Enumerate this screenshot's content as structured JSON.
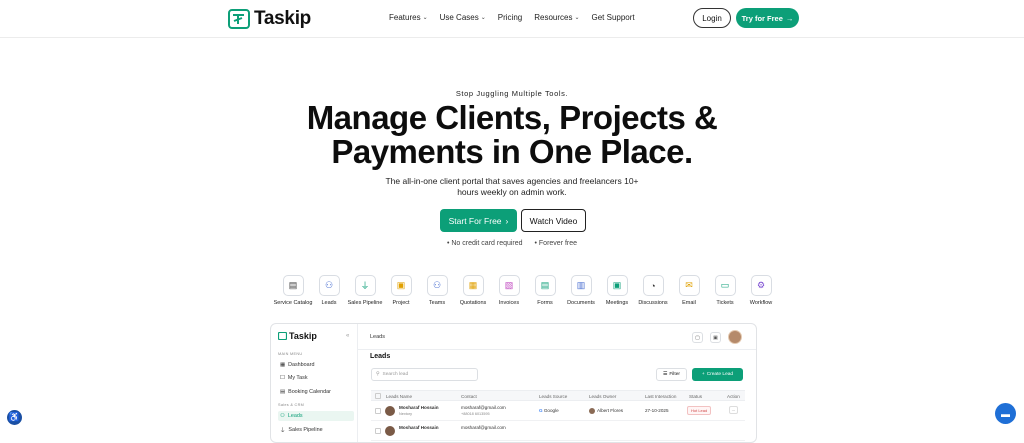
{
  "brand": {
    "name": "Taskip",
    "accent": "#0c9f78"
  },
  "nav": {
    "links": [
      {
        "label": "Features",
        "dropdown": true
      },
      {
        "label": "Use Cases",
        "dropdown": true
      },
      {
        "label": "Pricing",
        "dropdown": false
      },
      {
        "label": "Resources",
        "dropdown": true
      },
      {
        "label": "Get Support",
        "dropdown": false
      }
    ],
    "login": "Login",
    "try_free": "Try for Free"
  },
  "hero": {
    "eyebrow": "Stop Juggling Multiple Tools.",
    "headline_line1": "Manage Clients, Projects &",
    "headline_line2": "Payments in One Place.",
    "subtext": "The all-in-one client portal that saves agencies and freelancers 10+ hours weekly on admin work.",
    "start_button": "Start For Free",
    "watch_button": "Watch Video",
    "perk1": "• No credit card required",
    "perk2": "• Forever free"
  },
  "features": [
    {
      "label": "Service Catalog",
      "icon": "catalog-icon",
      "glyph": "▤",
      "color": "#3a3a3a"
    },
    {
      "label": "Leads",
      "icon": "leads-icon",
      "glyph": "⚇",
      "color": "#4a6fd1"
    },
    {
      "label": "Sales Pipeline",
      "icon": "pipeline-icon",
      "glyph": "⏚",
      "color": "#0c9f78"
    },
    {
      "label": "Project",
      "icon": "project-icon",
      "glyph": "▣",
      "color": "#e0a000"
    },
    {
      "label": "Teams",
      "icon": "teams-icon",
      "glyph": "⚇",
      "color": "#4a6fd1"
    },
    {
      "label": "Quotations",
      "icon": "quotations-icon",
      "glyph": "▦",
      "color": "#e0a000"
    },
    {
      "label": "Invoices",
      "icon": "invoices-icon",
      "glyph": "▧",
      "color": "#c04ac0"
    },
    {
      "label": "Forms",
      "icon": "forms-icon",
      "glyph": "▤",
      "color": "#0c9f78"
    },
    {
      "label": "Documents",
      "icon": "documents-icon",
      "glyph": "▥",
      "color": "#4a6fd1"
    },
    {
      "label": "Meetings",
      "icon": "meetings-icon",
      "glyph": "▣",
      "color": "#0c9f78"
    },
    {
      "label": "Discussions",
      "icon": "discussions-icon",
      "glyph": "◔",
      "color": "#333333"
    },
    {
      "label": "Email",
      "icon": "email-icon",
      "glyph": "✉",
      "color": "#e0a000"
    },
    {
      "label": "Tickets",
      "icon": "tickets-icon",
      "glyph": "▭",
      "color": "#0c9f78"
    },
    {
      "label": "Workflow",
      "icon": "workflow-icon",
      "glyph": "⚙",
      "color": "#7a4ad1"
    }
  ],
  "app": {
    "logo": "Taskip",
    "sidebar": {
      "section_main": "MAIN MENU",
      "section_sales": "Sales & CRM",
      "items": [
        {
          "label": "Dashboard",
          "icon": "dashboard-icon",
          "glyph": "▦",
          "active": false
        },
        {
          "label": "My Task",
          "icon": "task-icon",
          "glyph": "☐",
          "active": false
        },
        {
          "label": "Booking Calendar",
          "icon": "calendar-icon",
          "glyph": "▤",
          "active": false
        },
        {
          "label": "Leads",
          "icon": "leads-icon",
          "glyph": "⚇",
          "active": true
        },
        {
          "label": "Sales Pipeline",
          "icon": "pipeline-icon",
          "glyph": "⏚",
          "active": false
        }
      ]
    },
    "topbar_title": "Leads",
    "page_title": "Leads",
    "search_placeholder": "Search lead",
    "filter_label": "Filter",
    "create_label": "Create Lead",
    "columns": [
      "Leads Name",
      "Contact",
      "Leads Source",
      "Leads Owner",
      "Last Interaction",
      "Status",
      "Action"
    ],
    "rows": [
      {
        "name": "Mosharaf Hossain",
        "company": "Nextory",
        "email": "mosharaf@gmail.com",
        "phone": "+88018 6013595",
        "source": "Google",
        "owner": "Albert Flores",
        "last": "27-10-2025",
        "status": "Hot Lead"
      },
      {
        "name": "Mosharaf Hossain",
        "company": "",
        "email": "mosharaf@gmail.com",
        "phone": "",
        "source": "",
        "owner": "",
        "last": "",
        "status": ""
      }
    ]
  }
}
